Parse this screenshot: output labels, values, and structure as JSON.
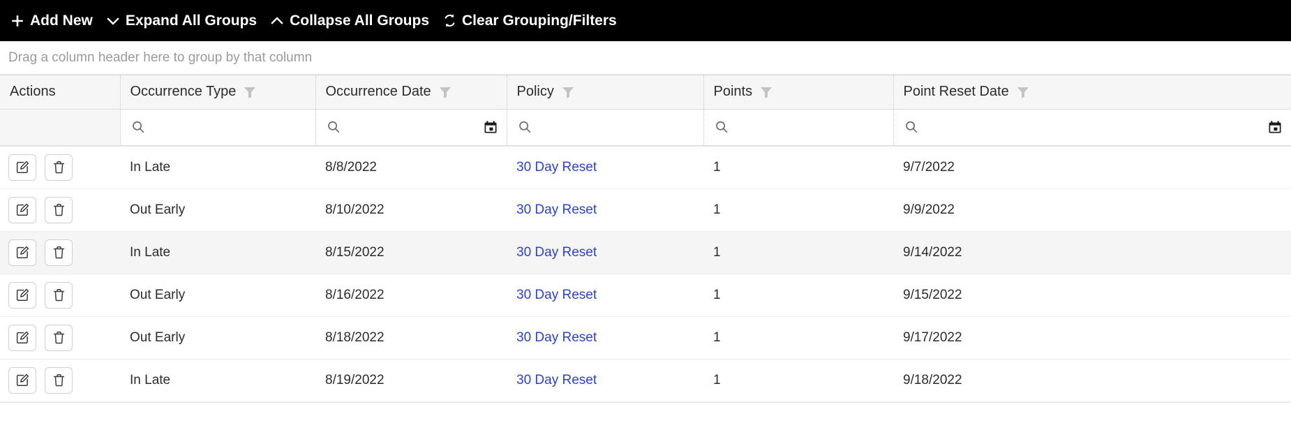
{
  "toolbar": {
    "buttons": [
      {
        "label": "Add New",
        "icon": "plus-icon"
      },
      {
        "label": "Expand All Groups",
        "icon": "chevron-down-icon"
      },
      {
        "label": "Collapse All Groups",
        "icon": "chevron-up-icon"
      },
      {
        "label": "Clear Grouping/Filters",
        "icon": "refresh-icon"
      }
    ]
  },
  "group_panel": {
    "hint": "Drag a column header here to group by that column"
  },
  "grid": {
    "columns": [
      {
        "key": "actions",
        "label": "Actions",
        "filter": "none",
        "has_funnel": false
      },
      {
        "key": "occurrence_type",
        "label": "Occurrence Type",
        "filter": "search",
        "has_funnel": true
      },
      {
        "key": "occurrence_date",
        "label": "Occurrence Date",
        "filter": "search-date",
        "has_funnel": true
      },
      {
        "key": "policy",
        "label": "Policy",
        "filter": "search",
        "has_funnel": true
      },
      {
        "key": "points",
        "label": "Points",
        "filter": "search",
        "has_funnel": true
      },
      {
        "key": "point_reset_date",
        "label": "Point Reset Date",
        "filter": "search-date",
        "has_funnel": true
      }
    ],
    "filter_values": {
      "occurrence_type": "",
      "occurrence_date": "",
      "policy": "",
      "points": "",
      "point_reset_date": ""
    },
    "row_actions": [
      {
        "name": "edit-button",
        "icon": "edit-pencil-icon"
      },
      {
        "name": "delete-button",
        "icon": "trash-icon"
      }
    ],
    "rows": [
      {
        "occurrence_type": "In Late",
        "occurrence_date": "8/8/2022",
        "policy": "30 Day Reset",
        "points": "1",
        "point_reset_date": "9/7/2022",
        "alt": false
      },
      {
        "occurrence_type": "Out Early",
        "occurrence_date": "8/10/2022",
        "policy": "30 Day Reset",
        "points": "1",
        "point_reset_date": "9/9/2022",
        "alt": false
      },
      {
        "occurrence_type": "In Late",
        "occurrence_date": "8/15/2022",
        "policy": "30 Day Reset",
        "points": "1",
        "point_reset_date": "9/14/2022",
        "alt": true
      },
      {
        "occurrence_type": "Out Early",
        "occurrence_date": "8/16/2022",
        "policy": "30 Day Reset",
        "points": "1",
        "point_reset_date": "9/15/2022",
        "alt": false
      },
      {
        "occurrence_type": "Out Early",
        "occurrence_date": "8/18/2022",
        "policy": "30 Day Reset",
        "points": "1",
        "point_reset_date": "9/17/2022",
        "alt": false
      },
      {
        "occurrence_type": "In Late",
        "occurrence_date": "8/19/2022",
        "policy": "30 Day Reset",
        "points": "1",
        "point_reset_date": "9/18/2022",
        "alt": false
      }
    ]
  },
  "colors": {
    "toolbar_bg": "#000000",
    "toolbar_text": "#ffffff",
    "link": "#2b3fe0",
    "header_bg": "#f6f6f6",
    "alt_row_bg": "#f5f5f5",
    "hint_text": "#9a9a9a",
    "funnel": "#c3c3c3"
  }
}
